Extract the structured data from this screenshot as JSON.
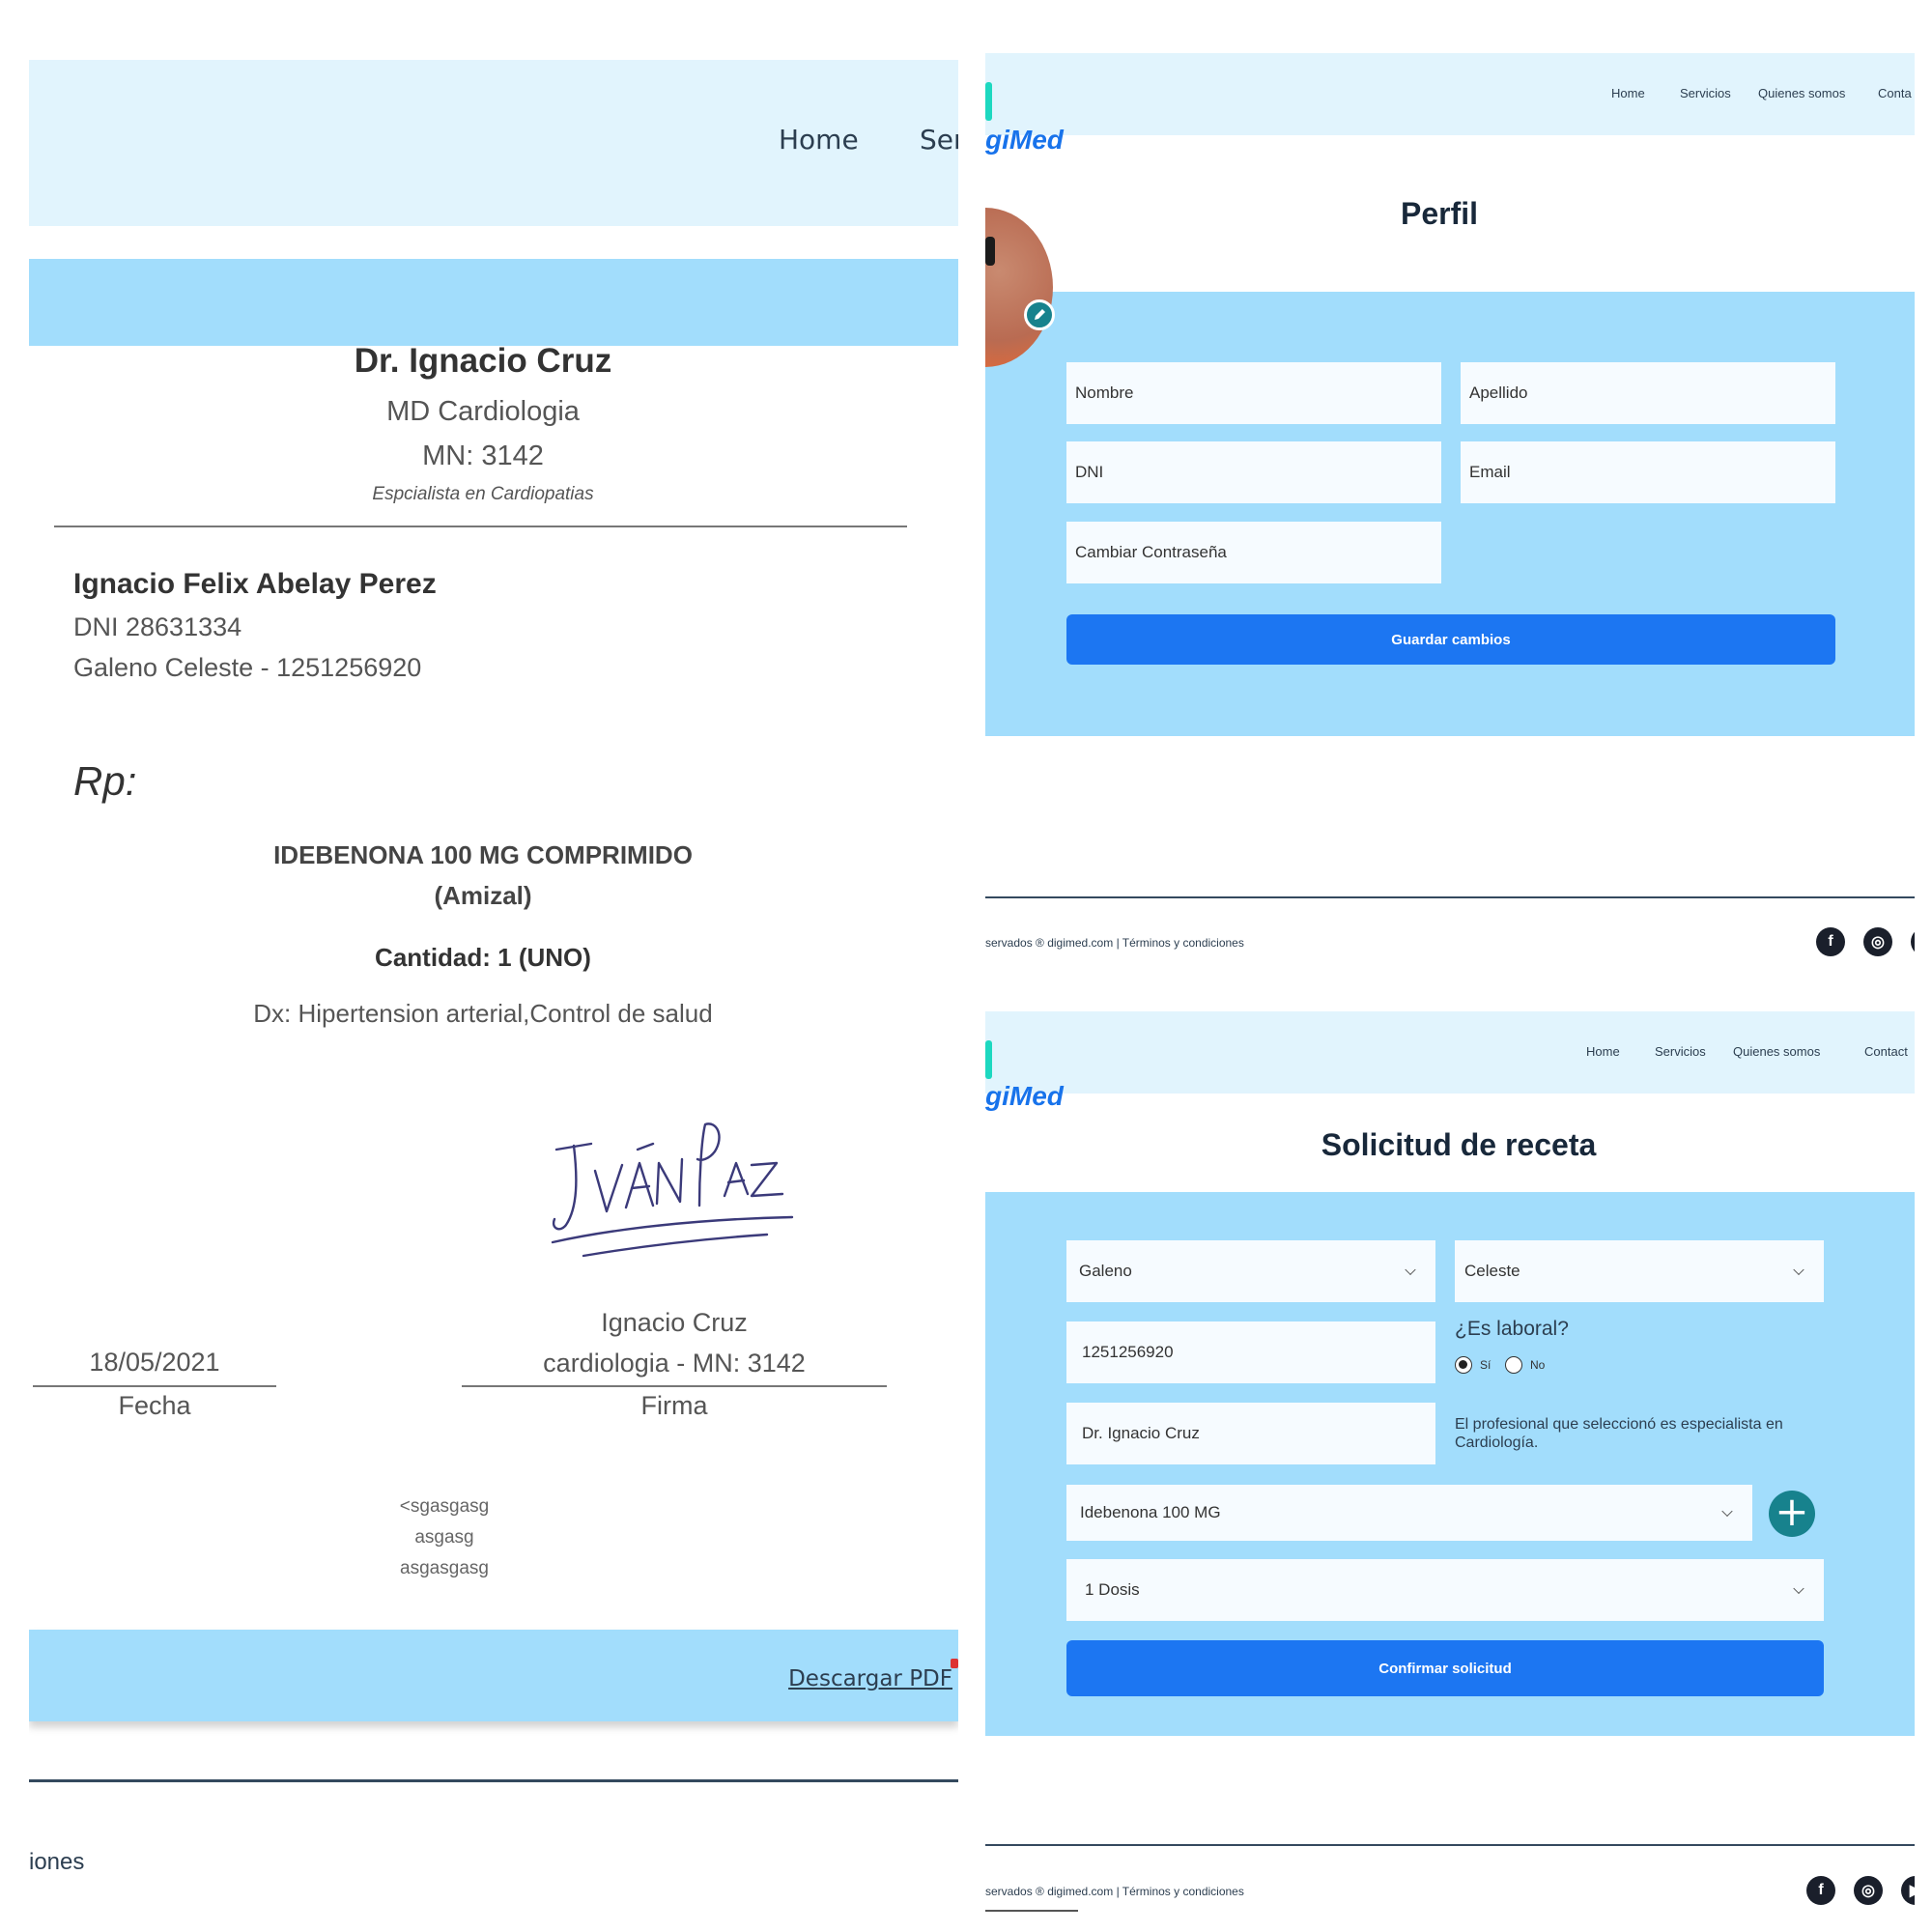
{
  "prescription": {
    "nav": {
      "home": "Home",
      "services_partial": "Ser"
    },
    "doctor": {
      "name": "Dr. Ignacio Cruz",
      "specialty": "MD Cardiologia",
      "license": "MN: 3142",
      "tagline": "Espcialista en Cardiopatias"
    },
    "patient": {
      "name": "Ignacio Felix Abelay Perez",
      "dni": "DNI 28631334",
      "insurance": "Galeno Celeste - 1251256920"
    },
    "rp_label": "Rp:",
    "medication_line1": "IDEBENONA 100 MG COMPRIMIDO",
    "medication_line2": "(Amizal)",
    "quantity": "Cantidad: 1 (UNO)",
    "diagnosis": "Dx: Hipertension arterial,Control de salud",
    "signature_text": "Iván Paz",
    "date_value": "18/05/2021",
    "date_label": "Fecha",
    "signer_name": "Ignacio Cruz",
    "signer_detail": "cardiologia - MN: 3142",
    "signature_label": "Firma",
    "notes": [
      "<sgasgasg",
      "asgasg",
      "asgasgasg"
    ],
    "download_label": "Descargar PDF",
    "footer_partial": "iones"
  },
  "profile": {
    "logo": "giMed",
    "nav": [
      "Home",
      "Servicios",
      "Quienes somos",
      "Conta"
    ],
    "title": "Perfil",
    "fields": {
      "first_name": "Nombre",
      "last_name": "Apellido",
      "dni": "DNI",
      "email": "Email",
      "password": "Cambiar Contraseña"
    },
    "save_label": "Guardar cambios",
    "copyright": "servados ® digimed.com  | Términos y condiciones",
    "social": [
      "facebook-icon",
      "instagram-icon",
      "third-social-icon"
    ]
  },
  "request": {
    "logo": "giMed",
    "nav": [
      "Home",
      "Servicios",
      "Quienes somos",
      "Contact"
    ],
    "title": "Solicitud de receta",
    "insurer": "Galeno",
    "plan": "Celeste",
    "member_number": "1251256920",
    "labor_question": "¿Es laboral?",
    "labor_options": [
      "Sí",
      "No"
    ],
    "labor_selected": "Sí",
    "doctor": "Dr. Ignacio Cruz",
    "specialist_note": "El profesional que seleccionó es especialista en Cardiología.",
    "medication": "Idebenona 100 MG",
    "dose": "1 Dosis",
    "confirm_label": "Confirmar solicitud",
    "copyright": "servados ® digimed.com  | Términos y condiciones",
    "colors": {
      "accent": "#1c76f2",
      "band": "#a2ddfc",
      "header": "#e1f4fd",
      "teal": "#17828d"
    }
  }
}
